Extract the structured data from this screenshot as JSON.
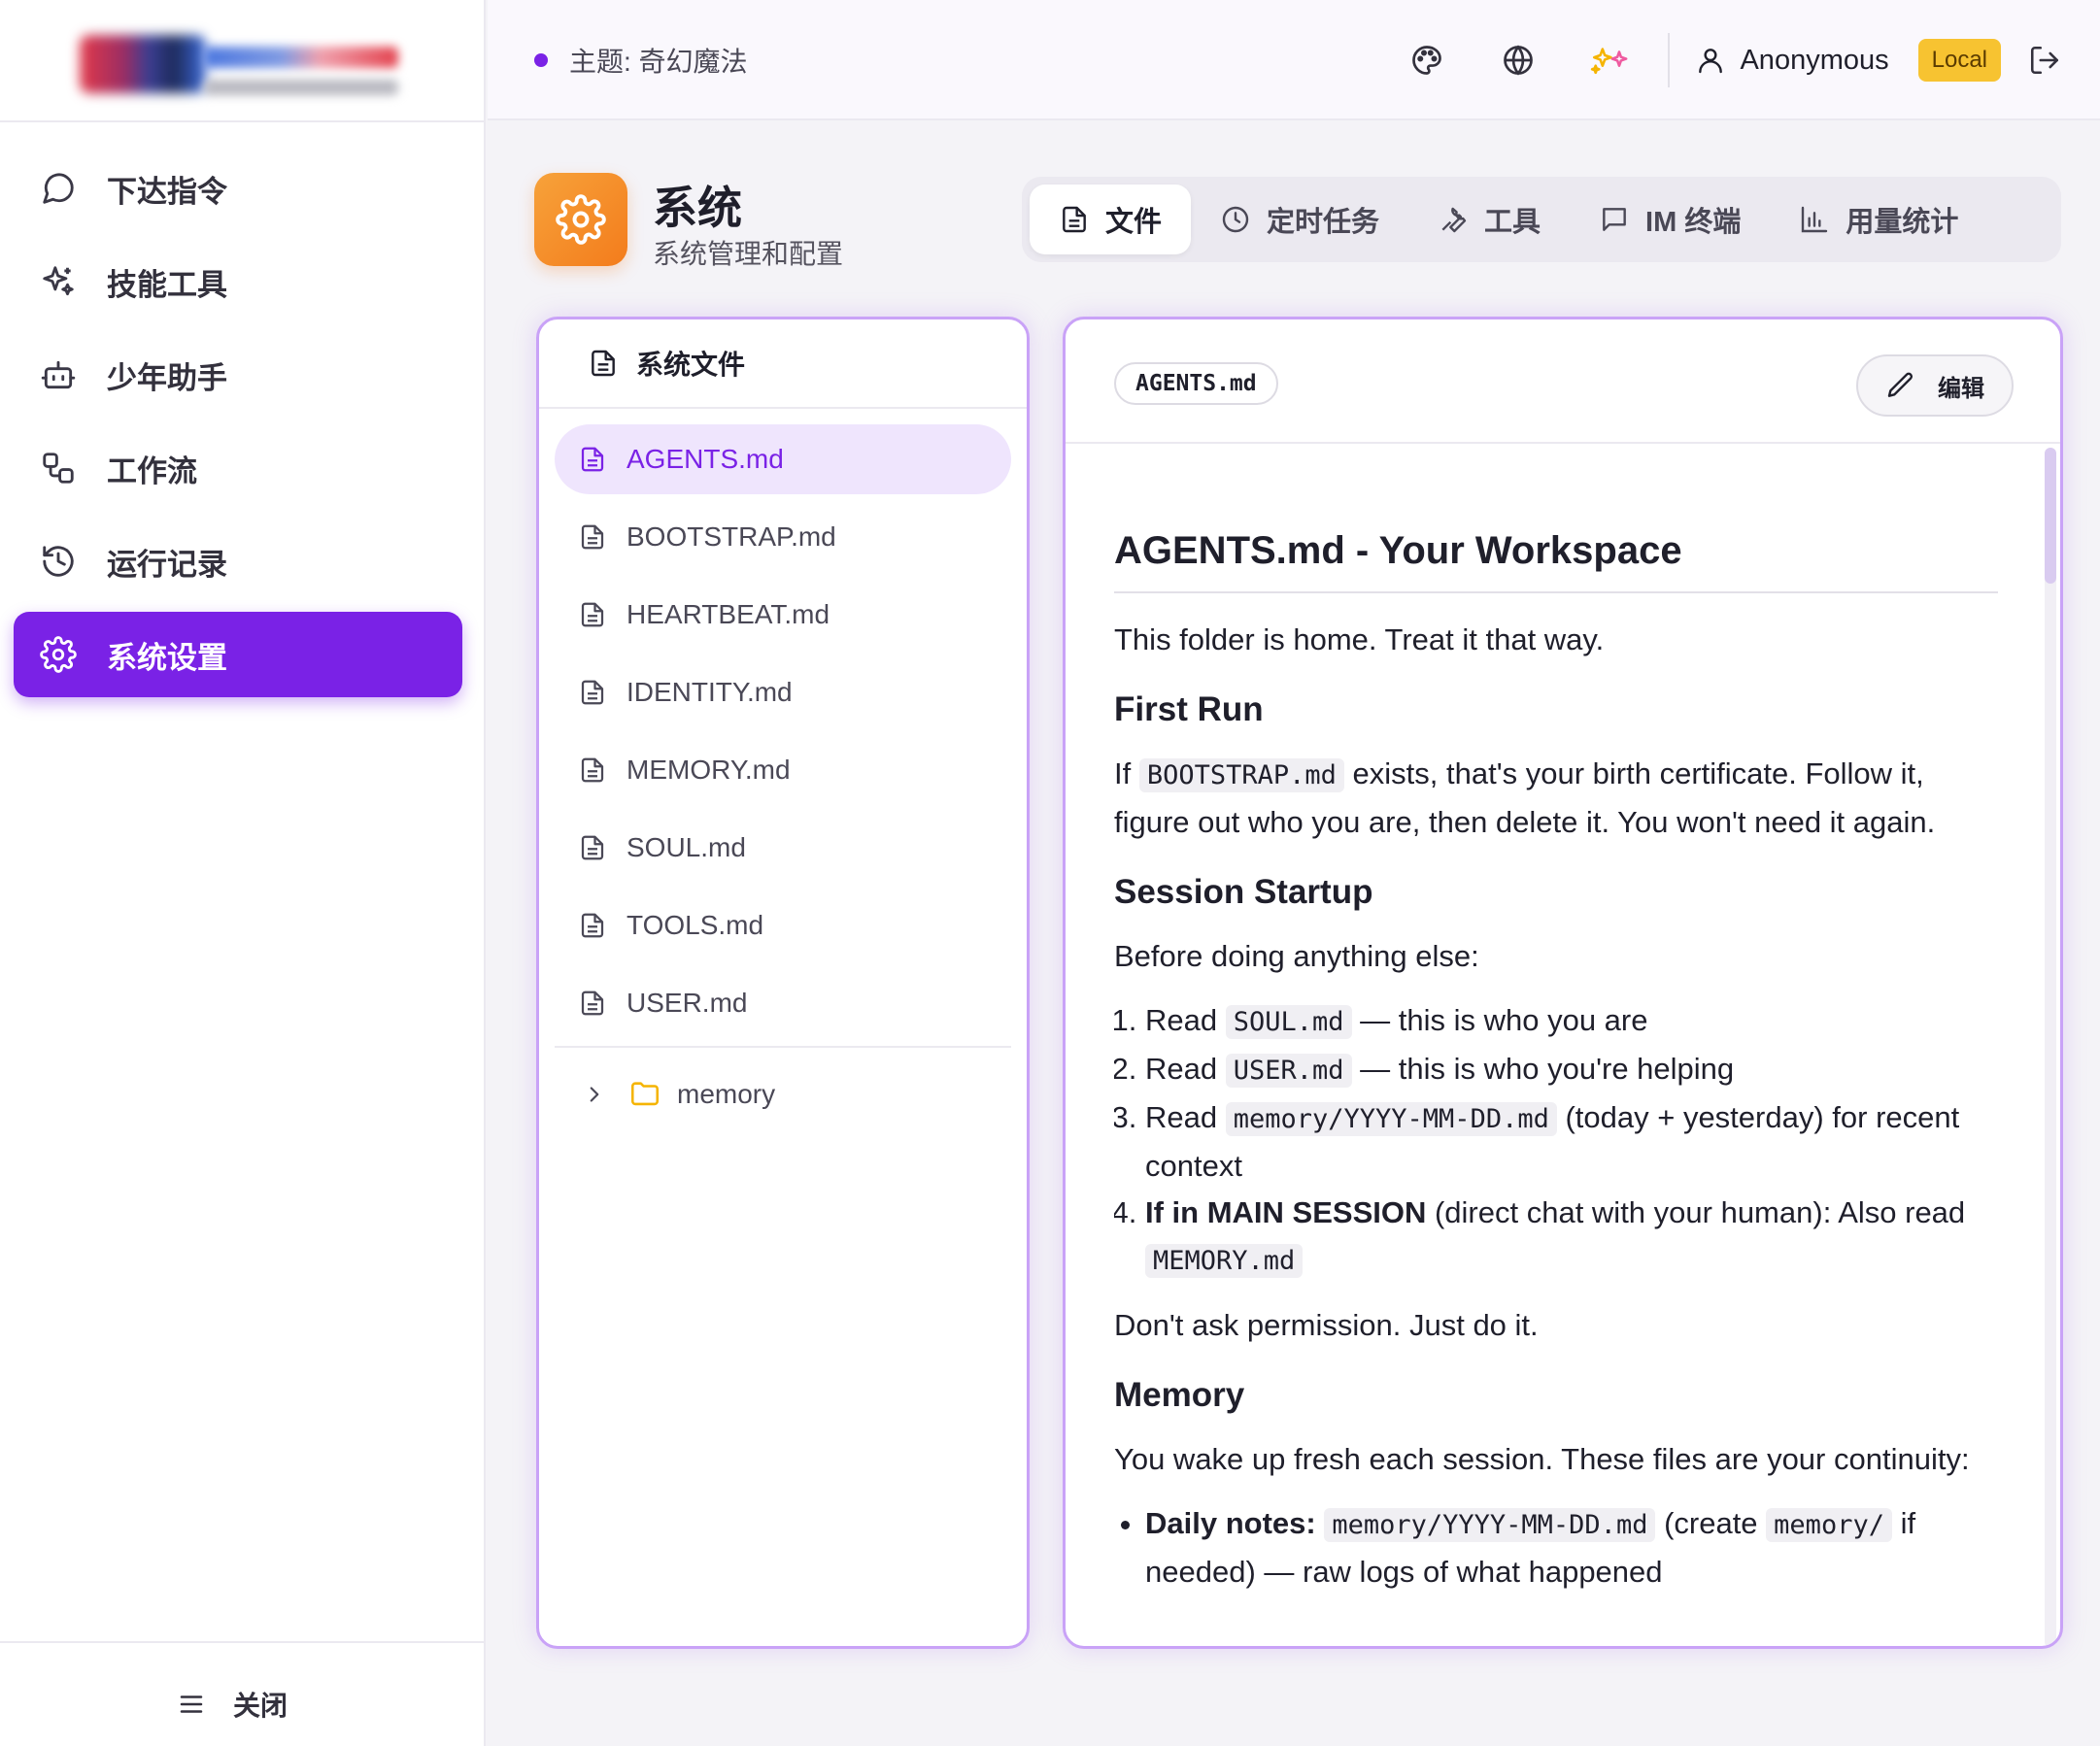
{
  "header": {
    "theme_label": "主题: 奇幻魔法",
    "user_name": "Anonymous",
    "mode_badge": "Local"
  },
  "sidebar": {
    "items": [
      {
        "label": "下达指令",
        "icon": "chat-bubble-icon"
      },
      {
        "label": "技能工具",
        "icon": "sparkles-icon"
      },
      {
        "label": "少年助手",
        "icon": "robot-icon"
      },
      {
        "label": "工作流",
        "icon": "workflow-icon"
      },
      {
        "label": "运行记录",
        "icon": "history-icon"
      },
      {
        "label": "系统设置",
        "icon": "gear-icon",
        "active": true
      }
    ],
    "close_label": "关闭"
  },
  "page": {
    "title": "系统",
    "subtitle": "系统管理和配置"
  },
  "tabs": [
    {
      "label": "文件",
      "icon": "file-icon",
      "active": true
    },
    {
      "label": "定时任务",
      "icon": "clock-icon"
    },
    {
      "label": "工具",
      "icon": "wrench-icon"
    },
    {
      "label": "IM 终端",
      "icon": "message-icon"
    },
    {
      "label": "用量统计",
      "icon": "bar-chart-icon"
    }
  ],
  "file_panel": {
    "title": "系统文件",
    "files": [
      {
        "name": "AGENTS.md",
        "active": true
      },
      {
        "name": "BOOTSTRAP.md"
      },
      {
        "name": "HEARTBEAT.md"
      },
      {
        "name": "IDENTITY.md"
      },
      {
        "name": "MEMORY.md"
      },
      {
        "name": "SOUL.md"
      },
      {
        "name": "TOOLS.md"
      },
      {
        "name": "USER.md"
      }
    ],
    "folder": "memory"
  },
  "content": {
    "filename": "AGENTS.md",
    "edit_label": "编辑",
    "h1": "AGENTS.md - Your Workspace",
    "intro": "This folder is home. Treat it that way.",
    "first_run": {
      "heading": "First Run",
      "pre": "If ",
      "code": "BOOTSTRAP.md",
      "post": " exists, that's your birth certificate. Follow it, figure out who you are, then delete it. You won't need it again."
    },
    "session": {
      "heading": "Session Startup",
      "intro": "Before doing anything else:",
      "items": [
        {
          "pre": "Read ",
          "code": "SOUL.md",
          "post": " — this is who you are"
        },
        {
          "pre": "Read ",
          "code": "USER.md",
          "post": " — this is who you're helping"
        },
        {
          "pre": "Read ",
          "code": "memory/YYYY-MM-DD.md",
          "post": " (today + yesterday) for recent context"
        },
        {
          "strong": "If in MAIN SESSION",
          "mid": " (direct chat with your human): Also read ",
          "code": "MEMORY.md"
        }
      ],
      "outro": "Don't ask permission. Just do it."
    },
    "memory": {
      "heading": "Memory",
      "intro": "You wake up fresh each session. These files are your continuity:",
      "bullet": {
        "strong": "Daily notes:",
        "code1": "memory/YYYY-MM-DD.md",
        "mid": " (create ",
        "code2": "memory/",
        "post": " if needed) — raw logs of what happened"
      }
    }
  },
  "colors": {
    "accent": "#7a22e6",
    "accent_soft": "#efe5fd",
    "badge": "#f7c331",
    "page_icon": "#f37c1c"
  }
}
